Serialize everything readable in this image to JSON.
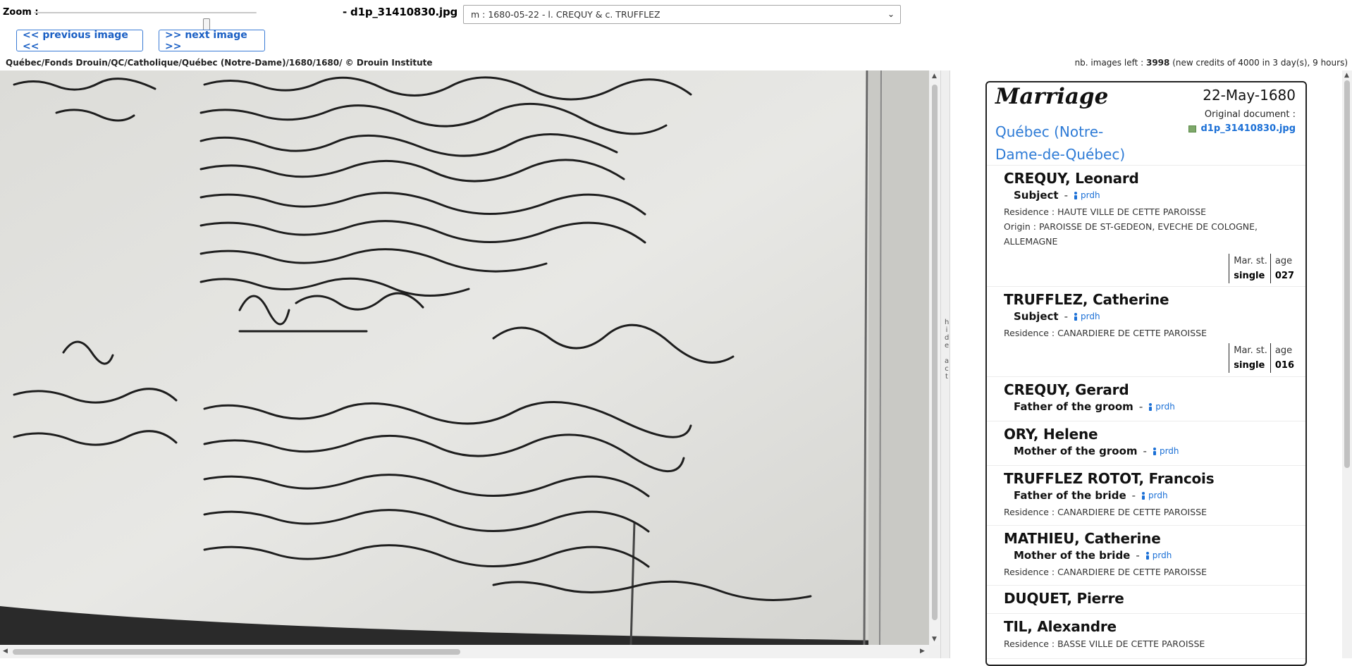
{
  "toolbar": {
    "zoom_label": "Zoom :",
    "filename": "- d1p_31410830.jpg",
    "record_select": "m : 1680-05-22 - l. CREQUY & c. TRUFFLEZ",
    "prev_label": "<< previous image <<",
    "next_label": ">> next image >>",
    "breadcrumb": "Québec/Fonds Drouin/QC/Catholique/Québec (Notre-Dame)/1680/1680/ © Drouin Institute",
    "images_left_label": "nb. images left : ",
    "images_left_count": "3998",
    "images_left_note": " (new credits of 4000 in 3 day(s), 9 hours)"
  },
  "divider": {
    "label": "hide act"
  },
  "act": {
    "type": "Marriage",
    "date": "22-May-1680",
    "parish": "Québec (Notre-Dame-de-Québec)",
    "original_label": "Original document :",
    "original_file": "d1p_31410830.jpg"
  },
  "people": [
    {
      "name": "CREQUY, Leonard",
      "role": "Subject",
      "prdh": "prdh",
      "residence": "Residence : HAUTE VILLE DE CETTE PAROISSE",
      "origin": "Origin : PAROISSE DE ST-GEDEON, EVECHE DE COLOGNE, ALLEMAGNE",
      "mar_label": "Mar. st.",
      "mar_value": "single",
      "age_label": "age",
      "age_value": "027"
    },
    {
      "name": "TRUFFLEZ, Catherine",
      "role": "Subject",
      "prdh": "prdh",
      "residence": "Residence : CANARDIERE DE CETTE PAROISSE",
      "mar_label": "Mar. st.",
      "mar_value": "single",
      "age_label": "age",
      "age_value": "016"
    },
    {
      "name": "CREQUY, Gerard",
      "role": "Father of the groom",
      "prdh": "prdh"
    },
    {
      "name": "ORY, Helene",
      "role": "Mother of the groom",
      "prdh": "prdh"
    },
    {
      "name": "TRUFFLEZ ROTOT, Francois",
      "role": "Father of the bride",
      "prdh": "prdh",
      "residence": "Residence : CANARDIERE DE CETTE PAROISSE"
    },
    {
      "name": "MATHIEU, Catherine",
      "role": "Mother of the bride",
      "prdh": "prdh",
      "residence": "Residence : CANARDIERE DE CETTE PAROISSE"
    },
    {
      "name": "DUQUET, Pierre"
    },
    {
      "name": "TIL, Alexandre",
      "residence": "Residence : BASSE VILLE DE CETTE PAROISSE"
    }
  ]
}
